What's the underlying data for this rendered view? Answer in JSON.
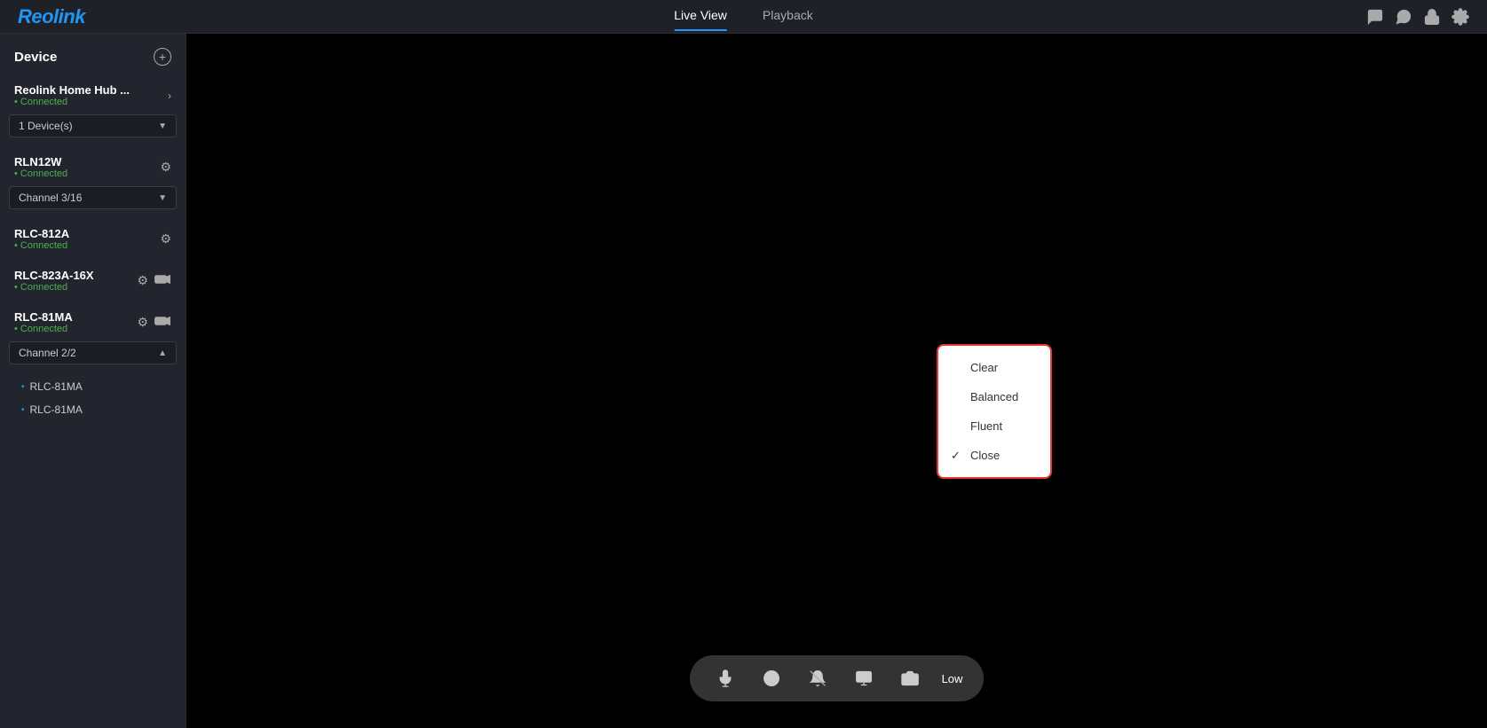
{
  "header": {
    "logo": "Reolink",
    "nav": [
      {
        "id": "live-view",
        "label": "Live View",
        "active": true
      },
      {
        "id": "playback",
        "label": "Playback",
        "active": false
      }
    ],
    "icons": [
      {
        "name": "chat-icon",
        "symbol": "💬"
      },
      {
        "name": "message-icon",
        "symbol": "🗨"
      },
      {
        "name": "lock-icon",
        "symbol": "🔒"
      },
      {
        "name": "settings-icon",
        "symbol": "⚙"
      }
    ]
  },
  "sidebar": {
    "title": "Device",
    "devices": [
      {
        "name": "Reolink Home Hub ...",
        "status": "Connected",
        "hasArrow": true,
        "hasGear": false,
        "hasCamera": false,
        "dropdown": "1 Device(s)",
        "dropdownOpen": false,
        "channels": []
      },
      {
        "name": "RLN12W",
        "status": "Connected",
        "hasArrow": false,
        "hasGear": true,
        "hasCamera": false,
        "dropdown": "Channel 3/16",
        "dropdownOpen": false,
        "channels": []
      },
      {
        "name": "RLC-812A",
        "status": "Connected",
        "hasArrow": false,
        "hasGear": true,
        "hasCamera": false,
        "dropdown": null,
        "channels": []
      },
      {
        "name": "RLC-823A-16X",
        "status": "Connected",
        "hasArrow": false,
        "hasGear": true,
        "hasCamera": true,
        "dropdown": null,
        "channels": []
      },
      {
        "name": "RLC-81MA",
        "status": "Connected",
        "hasArrow": false,
        "hasGear": true,
        "hasCamera": true,
        "dropdown": "Channel 2/2",
        "dropdownOpen": true,
        "channels": [
          "RLC-81MA",
          "RLC-81MA"
        ]
      }
    ]
  },
  "quality_popup": {
    "items": [
      {
        "label": "Clear",
        "checked": false
      },
      {
        "label": "Balanced",
        "checked": false
      },
      {
        "label": "Fluent",
        "checked": false
      },
      {
        "label": "Close",
        "checked": true
      }
    ]
  },
  "toolbar": {
    "quality_label": "Low",
    "icons": [
      {
        "name": "mic-icon",
        "symbol": "🎙"
      },
      {
        "name": "face-icon",
        "symbol": "😊"
      },
      {
        "name": "alarm-icon",
        "symbol": "🔔"
      },
      {
        "name": "screen-icon",
        "symbol": "⬜"
      },
      {
        "name": "camera-icon",
        "symbol": "📷"
      }
    ]
  }
}
